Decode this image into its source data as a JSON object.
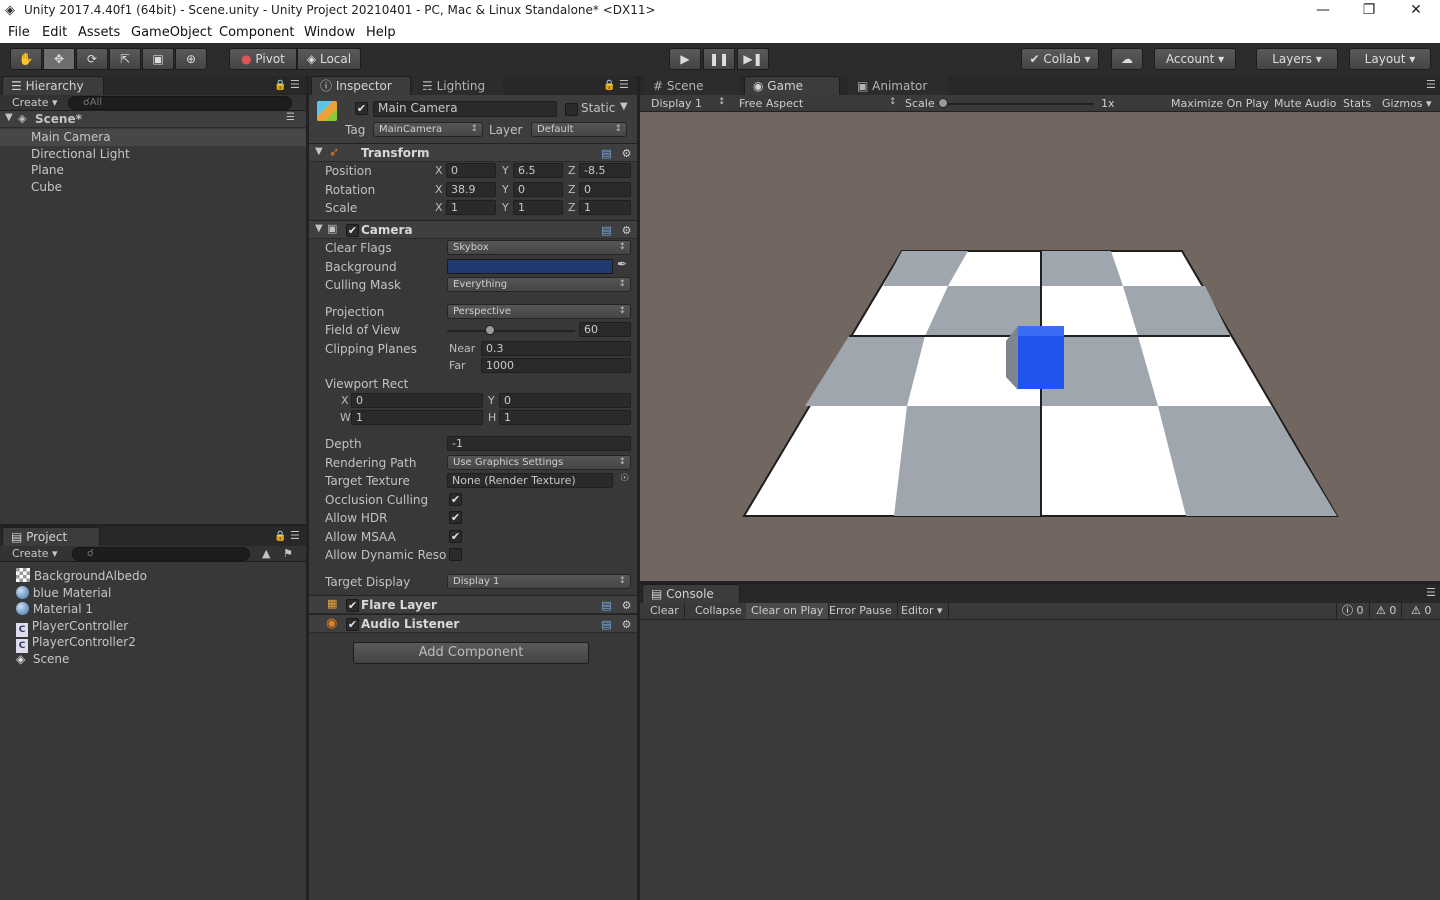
{
  "window": {
    "title": "Unity 2017.4.40f1 (64bit) - Scene.unity - Unity Project 20210401 - PC, Mac & Linux Standalone* <DX11>",
    "minimize": "—",
    "restore": "❐",
    "close": "✕"
  },
  "menu": [
    "File",
    "Edit",
    "Assets",
    "GameObject",
    "Component",
    "Window",
    "Help"
  ],
  "toolbar": {
    "pivot": "Pivot",
    "local": "Local",
    "collab": "Collab",
    "account": "Account",
    "layers": "Layers",
    "layout": "Layout"
  },
  "hierarchy": {
    "tab": "Hierarchy",
    "create": "Create",
    "search_placeholder": "All",
    "scene": "Scene*",
    "items": [
      "Main Camera",
      "Directional Light",
      "Plane",
      "Cube"
    ]
  },
  "project": {
    "tab": "Project",
    "create": "Create",
    "items": [
      "BackgroundAlbedo",
      "blue Material",
      "Material 1",
      "PlayerController",
      "PlayerController2",
      "Scene"
    ]
  },
  "inspector": {
    "tab": "Inspector",
    "tab2": "Lighting",
    "object_name": "Main Camera",
    "static_label": "Static",
    "tag_label": "Tag",
    "tag_value": "MainCamera",
    "layer_label": "Layer",
    "layer_value": "Default",
    "transform": {
      "title": "Transform",
      "position_label": "Position",
      "rotation_label": "Rotation",
      "scale_label": "Scale",
      "position": [
        "0",
        "6.5",
        "-8.5"
      ],
      "rotation": [
        "38.9",
        "0",
        "0"
      ],
      "scale": [
        "1",
        "1",
        "1"
      ]
    },
    "camera": {
      "title": "Camera",
      "clear_flags_label": "Clear Flags",
      "clear_flags": "Skybox",
      "background_label": "Background",
      "background_color": "#1f3a6e",
      "culling_mask_label": "Culling Mask",
      "culling_mask": "Everything",
      "projection_label": "Projection",
      "projection": "Perspective",
      "fov_label": "Field of View",
      "fov": "60",
      "clipping_label": "Clipping Planes",
      "near_label": "Near",
      "near": "0.3",
      "far_label": "Far",
      "far": "1000",
      "viewport_label": "Viewport Rect",
      "vx_label": "X",
      "vx": "0",
      "vy_label": "Y",
      "vy": "0",
      "vw_label": "W",
      "vw": "1",
      "vh_label": "H",
      "vh": "1",
      "depth_label": "Depth",
      "depth": "-1",
      "rendering_path_label": "Rendering Path",
      "rendering_path": "Use Graphics Settings",
      "target_texture_label": "Target Texture",
      "target_texture": "None (Render Texture)",
      "occlusion_label": "Occlusion Culling",
      "hdr_label": "Allow HDR",
      "msaa_label": "Allow MSAA",
      "dynres_label": "Allow Dynamic Reso",
      "target_display_label": "Target Display",
      "target_display": "Display 1"
    },
    "flare": "Flare Layer",
    "audio": "Audio Listener",
    "add_component": "Add Component"
  },
  "scene_tabs": {
    "scene": "Scene",
    "game": "Game",
    "animator": "Animator"
  },
  "game_bar": {
    "display": "Display 1",
    "aspect": "Free Aspect",
    "scale_label": "Scale",
    "scale_value": "1x",
    "maximize": "Maximize On Play",
    "mute": "Mute Audio",
    "stats": "Stats",
    "gizmos": "Gizmos"
  },
  "console": {
    "tab": "Console",
    "buttons": [
      "Clear",
      "Collapse",
      "Clear on Play",
      "Error Pause",
      "Editor"
    ],
    "log_count": "0",
    "warn_count": "0",
    "error_count": "0"
  },
  "colors": {
    "game_background": "#726760",
    "cube": "#1f55ee",
    "tile_gray": "#9fa6ad",
    "tile_white": "#ffffff"
  }
}
